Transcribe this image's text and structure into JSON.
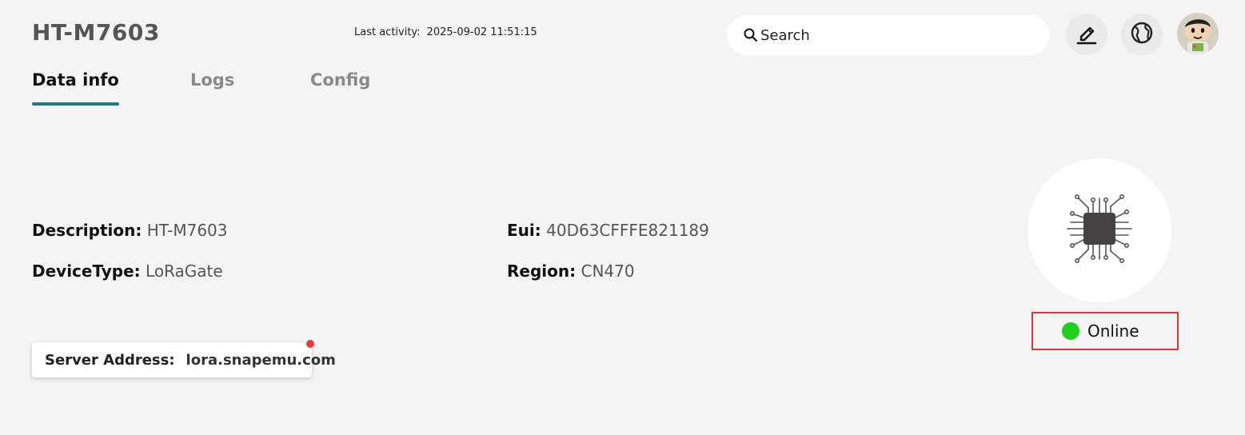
{
  "header": {
    "title": "HT-M7603",
    "last_activity_label": "Last activity:",
    "last_activity_value": "2025-09-02 11:51:15",
    "search_placeholder": "Search"
  },
  "tabs": [
    {
      "label": "Data info",
      "active": true
    },
    {
      "label": "Logs",
      "active": false
    },
    {
      "label": "Config",
      "active": false
    }
  ],
  "info": {
    "description_label": "Description:",
    "description_value": "HT-M7603",
    "device_type_label": "DeviceType:",
    "device_type_value": "LoRaGate",
    "eui_label": "Eui:",
    "eui_value": "40D63CFFFE821189",
    "region_label": "Region:",
    "region_value": "CN470"
  },
  "server": {
    "label": "Server Address:",
    "value": "lora.snapemu.com"
  },
  "status": {
    "label": "Online",
    "color": "#1fd01f"
  },
  "colors": {
    "accent": "#1a7f7a",
    "highlight_border": "#d9363e",
    "notification_dot": "#ee3b3b"
  }
}
